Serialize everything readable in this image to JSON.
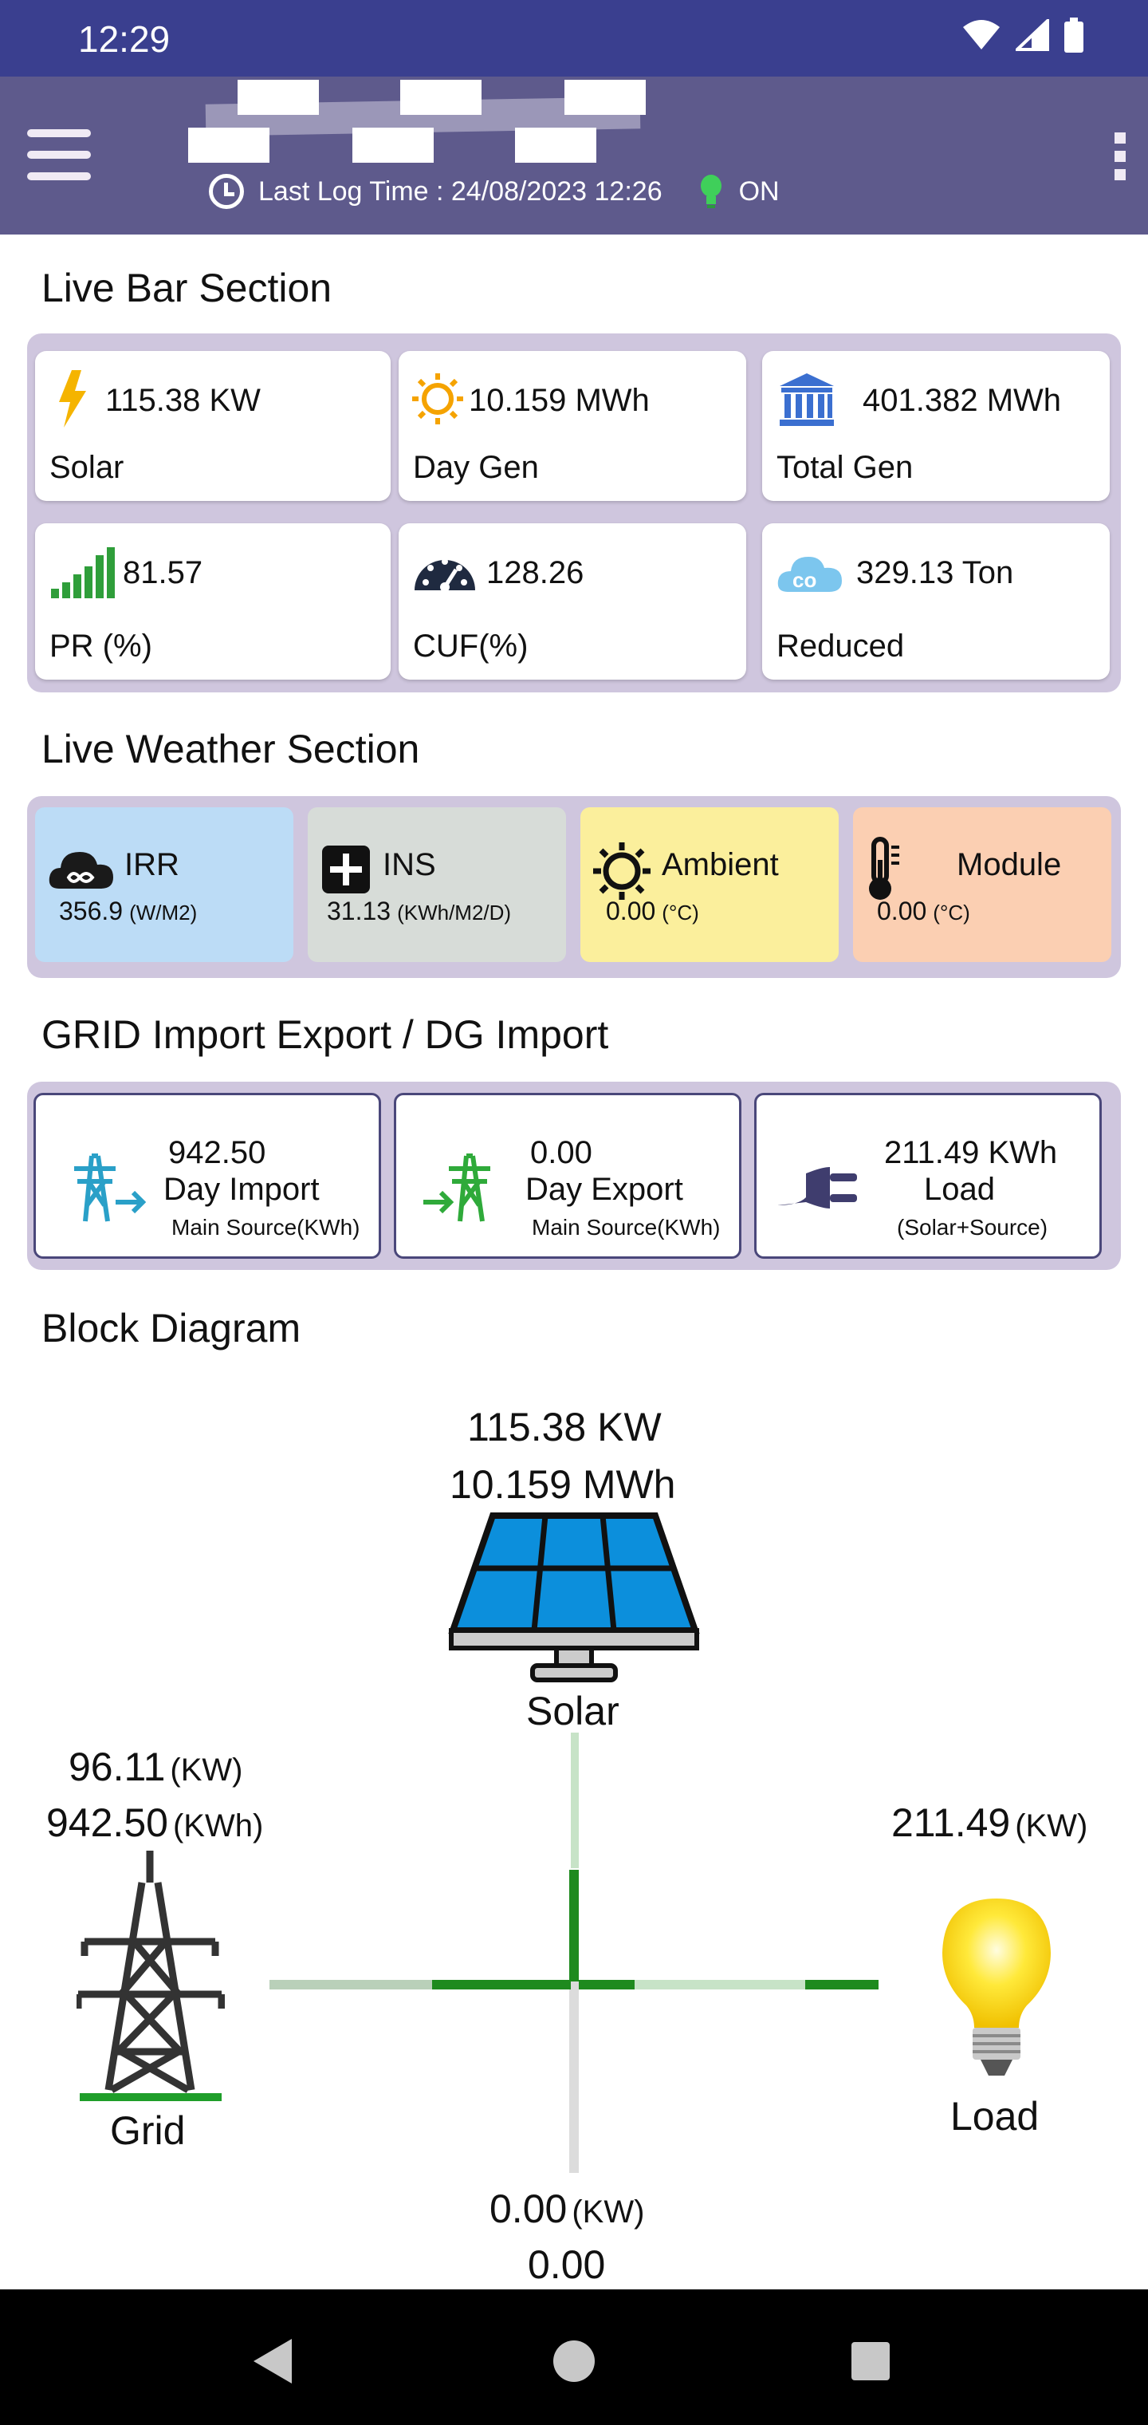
{
  "status_bar": {
    "time": "12:29"
  },
  "header": {
    "log_label": "Last Log Time : 24/08/2023 12:26",
    "status": "ON"
  },
  "live_bar": {
    "title": "Live Bar Section",
    "cards": [
      {
        "value": "115.38 KW",
        "label": "Solar",
        "icon": "lightning-icon"
      },
      {
        "value": "10.159 MWh",
        "label": "Day Gen",
        "icon": "sun-icon"
      },
      {
        "value": "401.382 MWh",
        "label": "Total Gen",
        "icon": "bank-icon"
      },
      {
        "value": "81.57",
        "label": "PR (%)",
        "icon": "signal-bars-icon"
      },
      {
        "value": "128.26",
        "label": "CUF(%)",
        "icon": "gauge-icon"
      },
      {
        "value": "329.13 Ton",
        "label": "Reduced",
        "icon": "co2-cloud-icon"
      }
    ]
  },
  "weather": {
    "title": "Live Weather Section",
    "cards": [
      {
        "name": "IRR",
        "value": "356.9",
        "unit": "(W/M2)",
        "color": "#bcdcf6"
      },
      {
        "name": "INS",
        "value": "31.13",
        "unit": "(KWh/M2/D)",
        "color": "#d7dcd8"
      },
      {
        "name": "Ambient",
        "value": "0.00",
        "unit": "(°C)",
        "color": "#fbef9c"
      },
      {
        "name": "Module",
        "value": "0.00",
        "unit": "(°C)",
        "color": "#fbcfb2"
      }
    ]
  },
  "grid_section": {
    "title": "GRID Import Export / DG Import",
    "cards": [
      {
        "value": "942.50",
        "title": "Day Import",
        "sub": "Main Source(KWh)"
      },
      {
        "value": "0.00",
        "title": "Day Export",
        "sub": "Main Source(KWh)"
      },
      {
        "value": "211.49 KWh",
        "title": "Load",
        "sub": "(Solar+Source)"
      }
    ]
  },
  "block_diagram": {
    "title": "Block Diagram",
    "solar": {
      "power": "115.38 KW",
      "energy": "10.159 MWh",
      "label": "Solar"
    },
    "grid": {
      "power": "96.11",
      "power_unit": "(KW)",
      "energy": "942.50",
      "energy_unit": "(KWh)",
      "label": "Grid"
    },
    "load": {
      "power": "211.49",
      "power_unit": "(KW)",
      "label": "Load"
    },
    "bottom": {
      "power": "0.00",
      "power_unit": "(KW)",
      "energy": "0.00"
    }
  },
  "colors": {
    "status_bar": "#3a3f8f",
    "app_bar": "#5e5a8c",
    "panel": "#cfc6de",
    "flow_active": "#1e8a1e",
    "flow_inactive": "#b9d9b9"
  }
}
